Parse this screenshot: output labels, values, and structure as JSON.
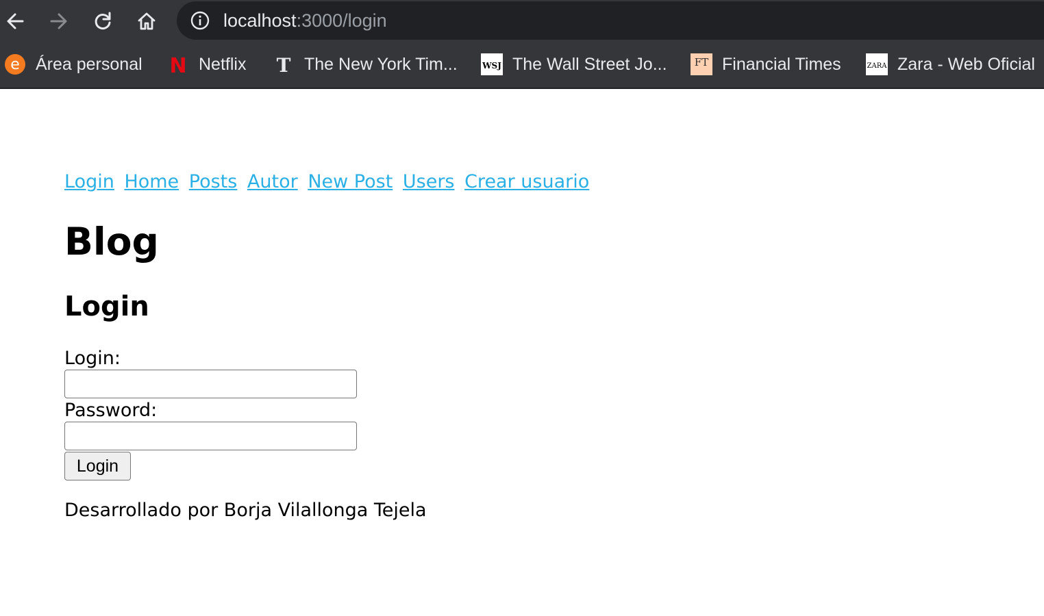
{
  "browser": {
    "url_host": "localhost",
    "url_rest": ":3000/login",
    "bookmarks": [
      {
        "label": "Área personal",
        "icon": "e-orange-circle-icon"
      },
      {
        "label": "Netflix",
        "icon": "netflix-icon"
      },
      {
        "label": "The New York Tim...",
        "icon": "nyt-icon"
      },
      {
        "label": "The Wall Street Jo...",
        "icon": "wsj-icon"
      },
      {
        "label": "Financial Times",
        "icon": "ft-icon"
      },
      {
        "label": "Zara - Web Oficial",
        "icon": "zara-icon"
      }
    ],
    "icon_text": {
      "area": "e",
      "netflix": "N",
      "nyt": "T",
      "wsj": "WSJ",
      "ft": "FT",
      "zara": "ZARA"
    }
  },
  "page": {
    "nav": [
      "Login",
      "Home",
      "Posts",
      "Autor",
      "New Post",
      "Users",
      "Crear usuario"
    ],
    "title": "Blog",
    "subtitle": "Login",
    "form": {
      "login_label": "Login:",
      "login_value": "",
      "password_label": "Password:",
      "password_value": "",
      "submit_label": "Login"
    },
    "footer": "Desarrollado por Borja Vilallonga Tejela"
  },
  "colors": {
    "link": "#2ab0e4",
    "chrome_bg": "#35363a",
    "omnibox_bg": "#202124"
  }
}
